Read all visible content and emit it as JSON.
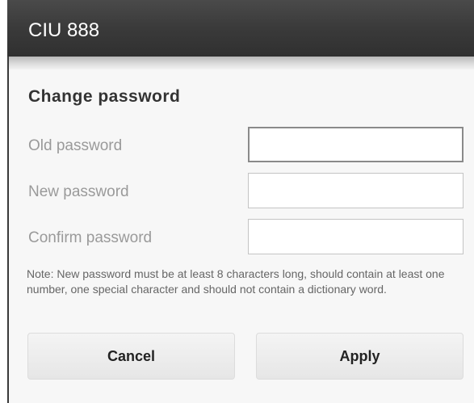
{
  "window": {
    "title": "CIU 888"
  },
  "dialog": {
    "title": "Change password",
    "fields": [
      {
        "label": "Old password",
        "value": "",
        "placeholder": ""
      },
      {
        "label": "New password",
        "value": "",
        "placeholder": ""
      },
      {
        "label": "Confirm password",
        "value": "",
        "placeholder": ""
      }
    ],
    "note": "Note: New password must be at least 8 characters long, should contain at least one number, one special character and should not contain a dictionary word.",
    "buttons": {
      "cancel_label": "Cancel",
      "apply_label": "Apply"
    }
  },
  "colors": {
    "titlebar": "#3a3a3a",
    "titlebar_text": "#ffffff",
    "dialog_bg": "#f7f7f7",
    "label": "#9a9a9a",
    "note": "#666666",
    "button_bg": "#ededed"
  }
}
